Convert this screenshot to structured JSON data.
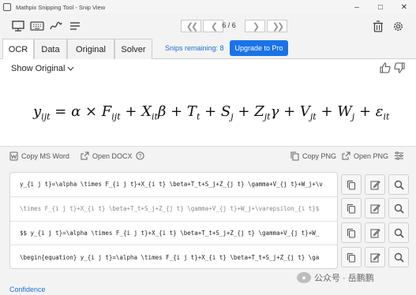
{
  "window": {
    "title": "Mathpix Snipping Tool - Snip View"
  },
  "toolbar": {
    "page_indicator": "6 / 6"
  },
  "tabs": [
    "OCR",
    "Data",
    "Original",
    "Solver"
  ],
  "snips": {
    "remaining": "Snips remaining: 8",
    "upgrade_label": "Upgrade to Pro"
  },
  "preview": {
    "show_original": "Show Original"
  },
  "actions": {
    "copy_ms_word": "Copy MS Word",
    "open_docx": "Open DOCX",
    "copy_png": "Copy PNG",
    "open_png": "Open PNG"
  },
  "results": [
    "y_{i j t}=\\alpha \\times F_{i j t}+X_{i t} \\beta+T_t+S_j+Z_{j t} \\gamma+V_{j t}+W_j+\\v",
    "\\times F_{i j t}+X_{i t} \\beta+T_t+S_j+Z_{j t} \\gamma+V_{j t}+W_j+\\varepsilon_{i t}$",
    "$$  y_{i j t}=\\alpha \\times F_{i j t}+X_{i t} \\beta+T_t+S_j+Z_{j t} \\gamma+V_{j t}+W_",
    "\\begin{equation}  y_{i j t}=\\alpha \\times F_{i j t}+X_{i t} \\beta+T_t+S_j+Z_{j t} \\ga"
  ],
  "footer": {
    "confidence": "Confidence"
  },
  "watermark": {
    "text": "公众号 · 岳鹏鹏"
  },
  "colors": {
    "accent": "#1a73e8",
    "link": "#1f6fd1"
  }
}
